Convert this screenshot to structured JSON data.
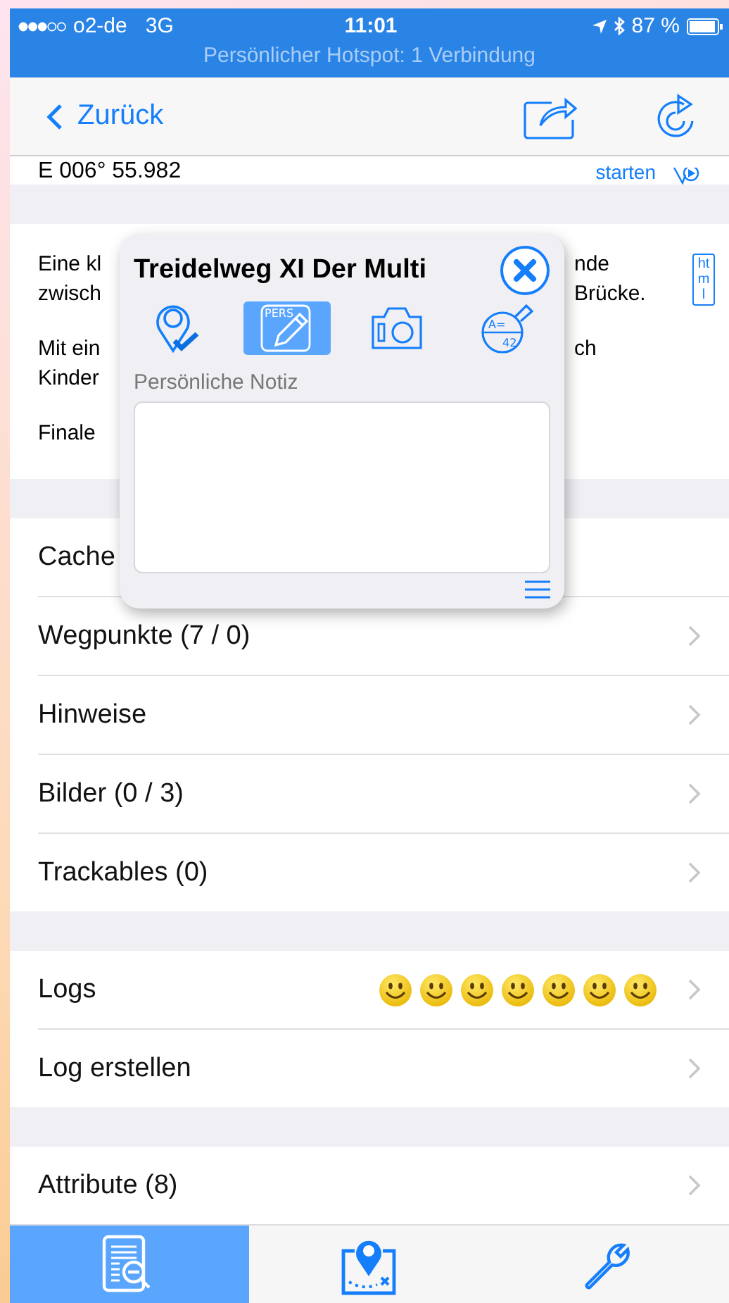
{
  "status_bar": {
    "carrier": "o2-de",
    "network": "3G",
    "time": "11:01",
    "battery": "87 %",
    "hotspot": "Persönlicher Hotspot: 1 Verbindung"
  },
  "nav_bar": {
    "back": "Zurück"
  },
  "coordinates": {
    "text": "E 006° 55.982",
    "action": "starten"
  },
  "description": {
    "lines": [
      {
        "left": "Eine kl",
        "right": "nde"
      },
      {
        "left": "zwisch",
        "right": "Brücke."
      },
      {
        "left": "Mit ein",
        "right": "ch",
        "gap_before": true
      },
      {
        "left": "Kinder"
      },
      {
        "left": "Finale",
        "gap_before": true
      }
    ],
    "badge": "html"
  },
  "popup": {
    "title": "Treidelweg XI Der Multi",
    "tabs": [
      {
        "kind": "waypoint",
        "selected": false
      },
      {
        "kind": "note",
        "selected": true,
        "label": "PERS"
      },
      {
        "kind": "camera",
        "selected": false
      },
      {
        "kind": "formula",
        "selected": false,
        "labels": [
          "A=",
          "42"
        ]
      }
    ],
    "field_label": "Persönliche Notiz"
  },
  "sections": [
    [
      {
        "label": "Cache"
      },
      {
        "label": "Wegpunkte (7 / 0)"
      },
      {
        "label": "Hinweise"
      },
      {
        "label": "Bilder (0 / 3)"
      },
      {
        "label": "Trackables (0)"
      }
    ],
    [
      {
        "label": "Logs",
        "smileys": [
          {
            "kind": "smile"
          },
          {
            "kind": "smile"
          },
          {
            "kind": "smile"
          },
          {
            "kind": "smile"
          },
          {
            "kind": "smile"
          },
          {
            "kind": "smile"
          },
          {
            "kind": "smile"
          }
        ]
      },
      {
        "label": "Log erstellen"
      }
    ],
    [
      {
        "label": "Attribute (8)"
      }
    ]
  ],
  "tab_bar": [
    {
      "kind": "details",
      "selected": true
    },
    {
      "kind": "map",
      "selected": false
    },
    {
      "kind": "tools",
      "selected": false
    }
  ]
}
